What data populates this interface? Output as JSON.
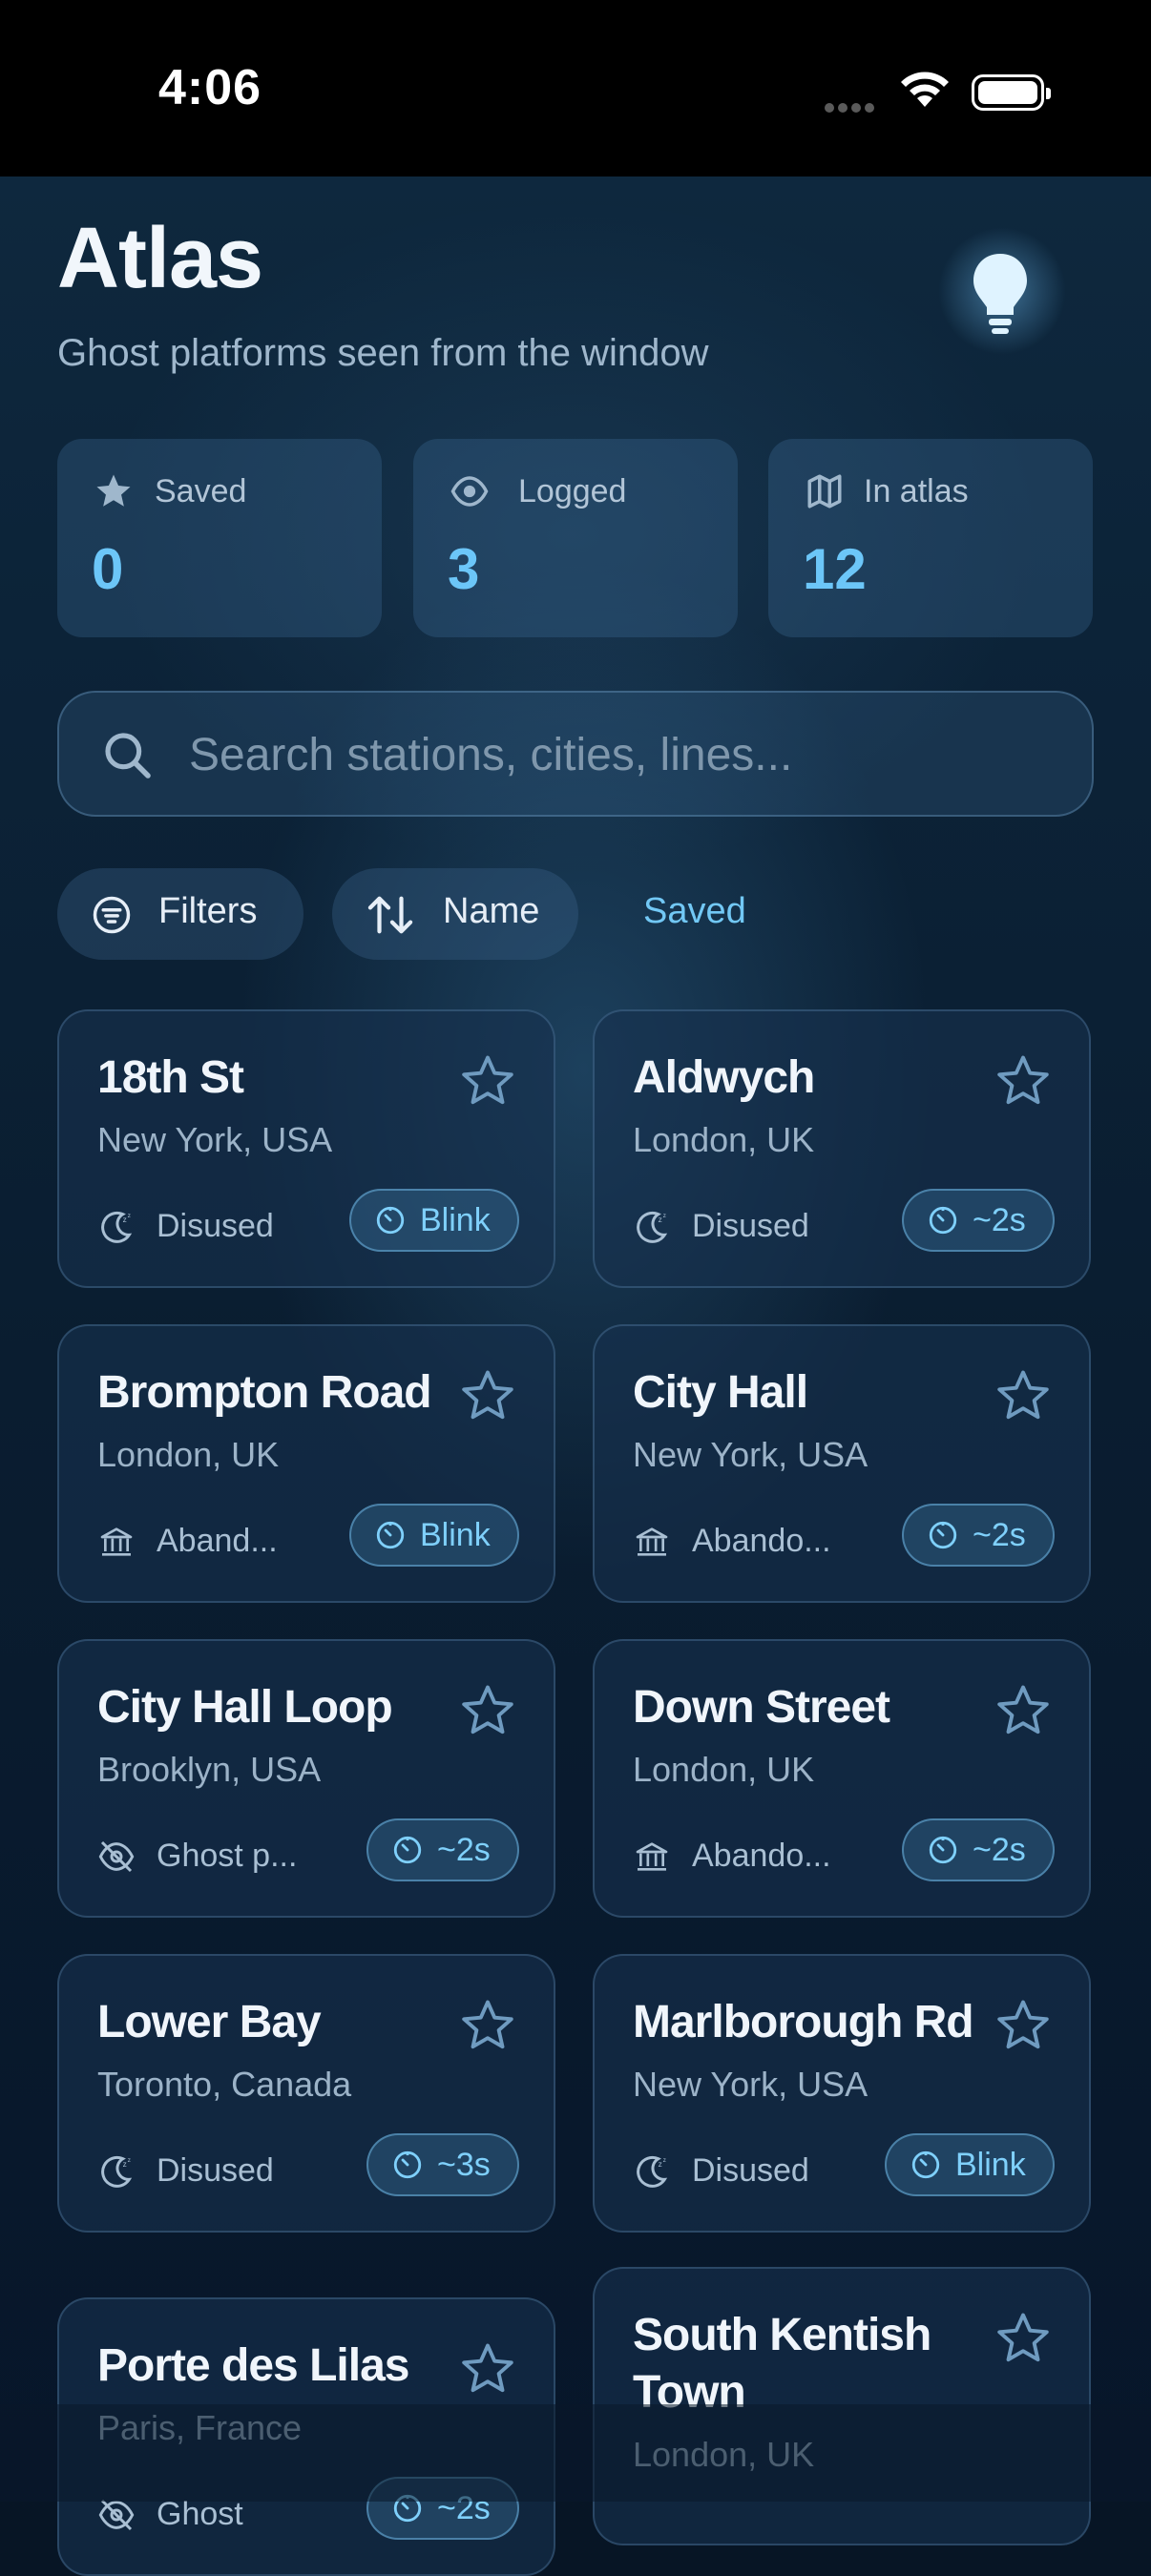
{
  "status_bar": {
    "time": "4:06"
  },
  "header": {
    "title": "Atlas",
    "subtitle": "Ghost platforms seen from the window"
  },
  "stats": [
    {
      "label": "Saved",
      "value": "0",
      "icon": "star-icon"
    },
    {
      "label": "Logged",
      "value": "3",
      "icon": "eye-icon"
    },
    {
      "label": "In atlas",
      "value": "12",
      "icon": "map-icon"
    }
  ],
  "search": {
    "placeholder": "Search stations, cities, lines..."
  },
  "filters": {
    "filters_label": "Filters",
    "sort_label": "Name",
    "saved_label": "Saved"
  },
  "colors": {
    "accent": "#6cc6f8",
    "background": "#0a1d30",
    "card": "#16304e"
  },
  "stations": [
    {
      "name": "18th St",
      "location": "New York, USA",
      "tag": "Disused",
      "tag_icon": "moon-icon",
      "badge": "Blink"
    },
    {
      "name": "Aldwych",
      "location": "London, UK",
      "tag": "Disused",
      "tag_icon": "moon-icon",
      "badge": "~2s"
    },
    {
      "name": "Brompton Road",
      "location": "London, UK",
      "tag": "Aband...",
      "tag_icon": "building-icon",
      "badge": "Blink"
    },
    {
      "name": "City Hall",
      "location": "New York, USA",
      "tag": "Abando...",
      "tag_icon": "building-icon",
      "badge": "~2s"
    },
    {
      "name": "City Hall Loop",
      "location": "Brooklyn, USA",
      "tag": "Ghost p...",
      "tag_icon": "eye-off-icon",
      "badge": "~2s"
    },
    {
      "name": "Down Street",
      "location": "London, UK",
      "tag": "Abando...",
      "tag_icon": "building-icon",
      "badge": "~2s"
    },
    {
      "name": "Lower Bay",
      "location": "Toronto, Canada",
      "tag": "Disused",
      "tag_icon": "moon-icon",
      "badge": "~3s"
    },
    {
      "name": "Marlborough Rd",
      "location": "New York, USA",
      "tag": "Disused",
      "tag_icon": "moon-icon",
      "badge": "Blink"
    },
    {
      "name": "Porte des Lilas",
      "location": "Paris, France",
      "tag": "Ghost",
      "tag_icon": "eye-off-icon",
      "badge": "~2s"
    },
    {
      "name": "South Kentish Town",
      "location": "London, UK",
      "tag": "",
      "tag_icon": "",
      "badge": ""
    }
  ]
}
